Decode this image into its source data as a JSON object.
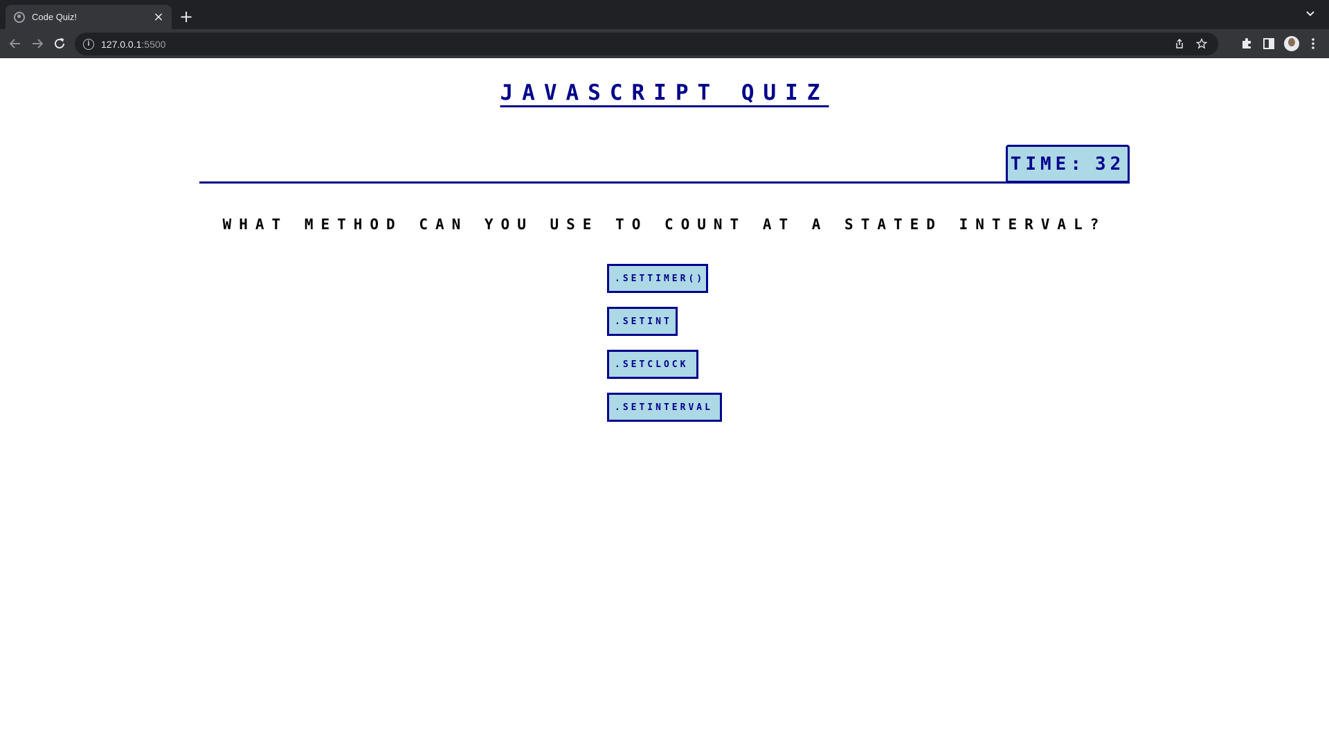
{
  "browser": {
    "tab_title": "Code Quiz!",
    "tab_close": "×",
    "new_tab": "+",
    "url_host": "127.0.0.1",
    "url_port": ":5500"
  },
  "quiz": {
    "title": "JAVASCRIPT QUIZ",
    "timer_label": "TIME:",
    "timer_value": "32",
    "question": "WHAT METHOD CAN YOU USE TO COUNT AT A STATED INTERVAL?",
    "choices": [
      ".SETTIMER()",
      ".SETINT",
      ".SETCLOCK",
      ".SETINTERVAL"
    ]
  },
  "colors": {
    "accent": "#00008b",
    "button_bg": "#add8e6",
    "chrome_dark": "#202124",
    "chrome_toolbar": "#35363a"
  }
}
